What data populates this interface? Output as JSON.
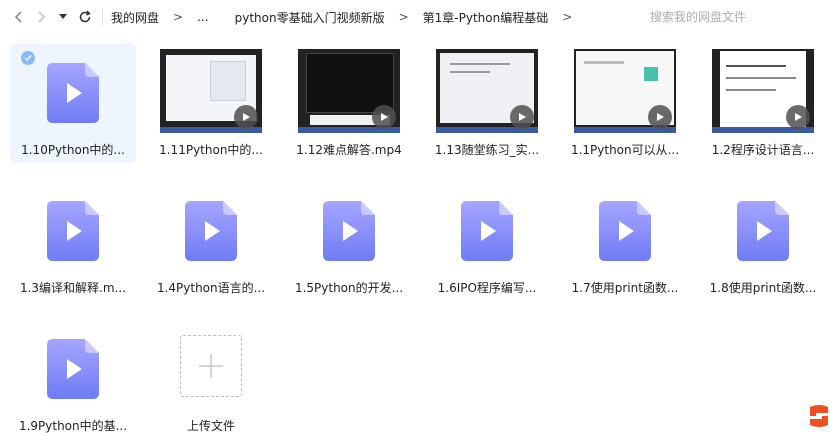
{
  "toolbar": {
    "breadcrumbs": [
      "我的网盘",
      "...",
      "python零基础入门视频新版",
      "第1章-Python编程基础"
    ],
    "separator": ">",
    "search_placeholder": "搜索我的网盘文件"
  },
  "files": [
    {
      "label": "1.10Python中的...",
      "kind": "video-icon",
      "selected": true
    },
    {
      "label": "1.11Python中的...",
      "kind": "thumbnail",
      "thumb": "ide"
    },
    {
      "label": "1.12难点解答.mp4",
      "kind": "thumbnail",
      "thumb": "console"
    },
    {
      "label": "1.13随堂练习_实...",
      "kind": "thumbnail",
      "thumb": "editor"
    },
    {
      "label": "1.1Python可以从...",
      "kind": "thumbnail",
      "thumb": "web"
    },
    {
      "label": "1.2程序设计语言...",
      "kind": "thumbnail",
      "thumb": "slide"
    },
    {
      "label": "1.3编译和解释.m...",
      "kind": "video-icon"
    },
    {
      "label": "1.4Python语言的...",
      "kind": "video-icon"
    },
    {
      "label": "1.5Python的开发...",
      "kind": "video-icon"
    },
    {
      "label": "1.6IPO程序编写...",
      "kind": "video-icon"
    },
    {
      "label": "1.7使用print函数...",
      "kind": "video-icon"
    },
    {
      "label": "1.8使用print函数...",
      "kind": "video-icon"
    },
    {
      "label": "1.9Python中的基...",
      "kind": "video-icon"
    }
  ],
  "upload": {
    "label": "上传文件"
  },
  "colors": {
    "file_icon_top": "#a6a5ff",
    "file_icon_bottom": "#6f7cf5",
    "selected_bg": "#eef5ff",
    "logo": "#f04e23"
  }
}
